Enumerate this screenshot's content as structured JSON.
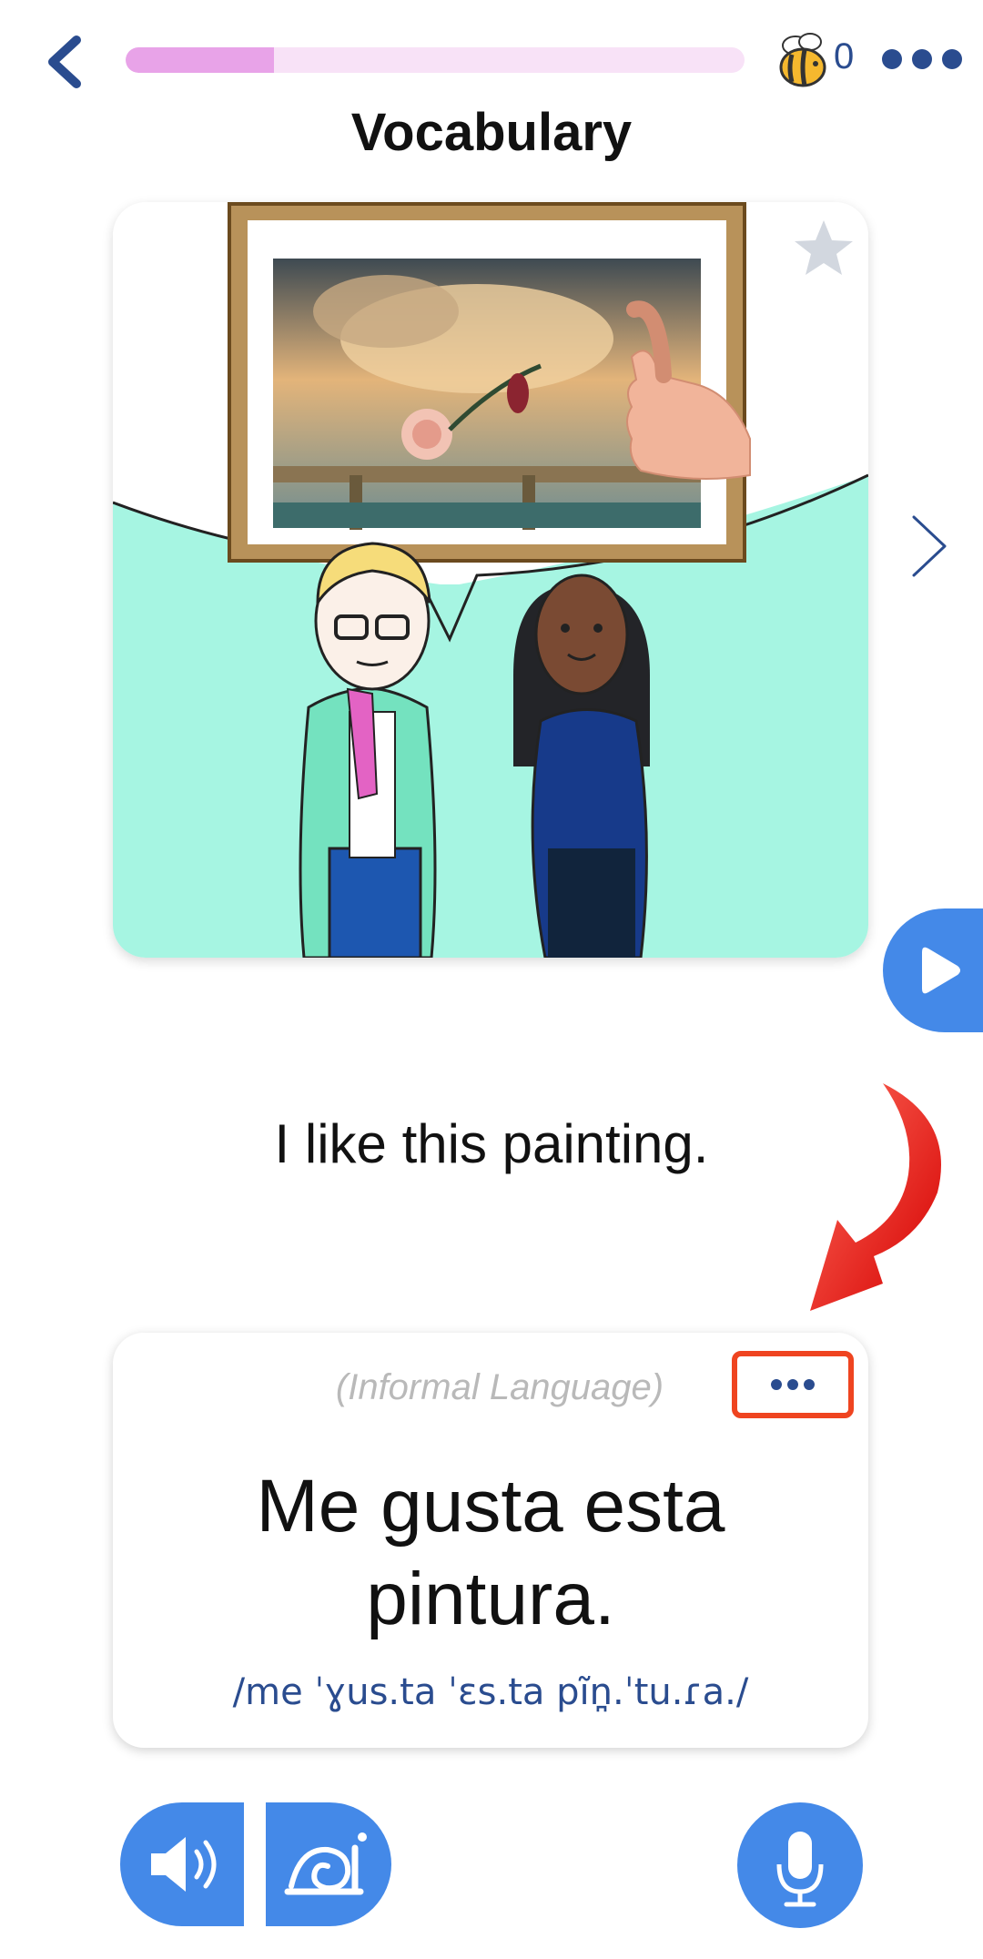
{
  "header": {
    "title": "Vocabulary",
    "progress": 0.24,
    "score": "0"
  },
  "card": {
    "sentence_english": "I like this painting.",
    "register_label": "(Informal Language)",
    "sentence_spanish_line1": "Me gusta esta",
    "sentence_spanish_line2": "pintura.",
    "ipa": "/me ˈɣus.ta ˈɛs.ta pĩn̪.ˈtu.ɾa./"
  },
  "colors": {
    "accent": "#4489e8",
    "progress_fill": "#e8a3e8",
    "progress_track": "#f8e2f7",
    "highlight": "#ef4420",
    "ipa_text": "#2a4c8f"
  },
  "icons": {
    "back": "chevron-left-icon",
    "bee": "bee-icon",
    "more": "more-dots-icon",
    "star": "star-icon",
    "next": "chevron-right-icon",
    "play": "play-icon",
    "speaker": "speaker-icon",
    "slow": "snail-icon",
    "mic": "microphone-icon"
  }
}
